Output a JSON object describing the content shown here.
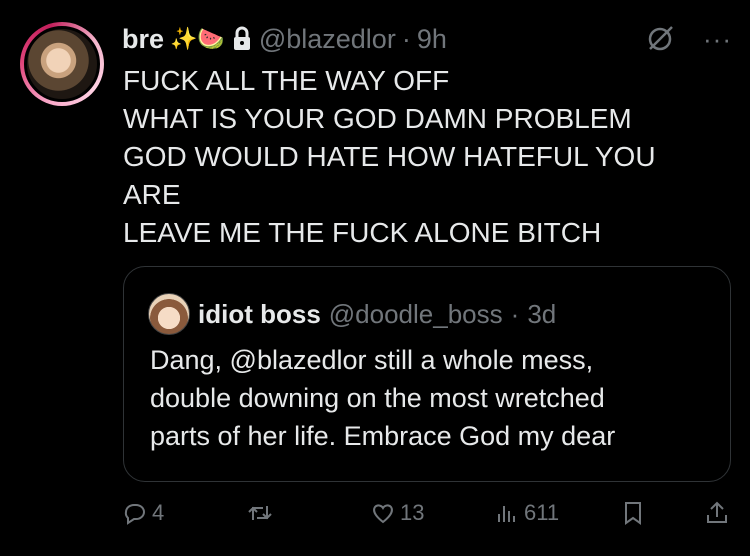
{
  "user": {
    "name": "bre",
    "emojis": "✨🍉",
    "handle": "@blazedlor",
    "separator": "·",
    "time": "9h"
  },
  "tweet": {
    "lines": [
      "FUCK ALL THE WAY OFF",
      "WHAT IS YOUR GOD DAMN PROBLEM",
      "GOD WOULD HATE HOW HATEFUL YOU",
      "ARE",
      "LEAVE ME THE FUCK ALONE BITCH"
    ]
  },
  "quote": {
    "name": "idiot boss",
    "handle": "@doodle_boss",
    "separator": "·",
    "time": "3d",
    "lines": [
      "Dang, @blazedlor still a whole mess,",
      "double downing on the most wretched",
      "parts of her life. Embrace God my dear"
    ]
  },
  "actions": {
    "replies": "4",
    "retweets": "",
    "likes": "13",
    "views": "611"
  },
  "icons": {
    "reply": "reply-icon",
    "retweet": "retweet-icon",
    "like": "heart-icon",
    "views": "views-icon",
    "bookmark": "bookmark-icon",
    "share": "share-icon",
    "grok": "grok-icon",
    "more": "more-icon",
    "lock": "lock-icon"
  },
  "colors": {
    "background": "#000000",
    "text": "#e7e9ea",
    "muted": "#71767b",
    "border": "#2f3336"
  }
}
